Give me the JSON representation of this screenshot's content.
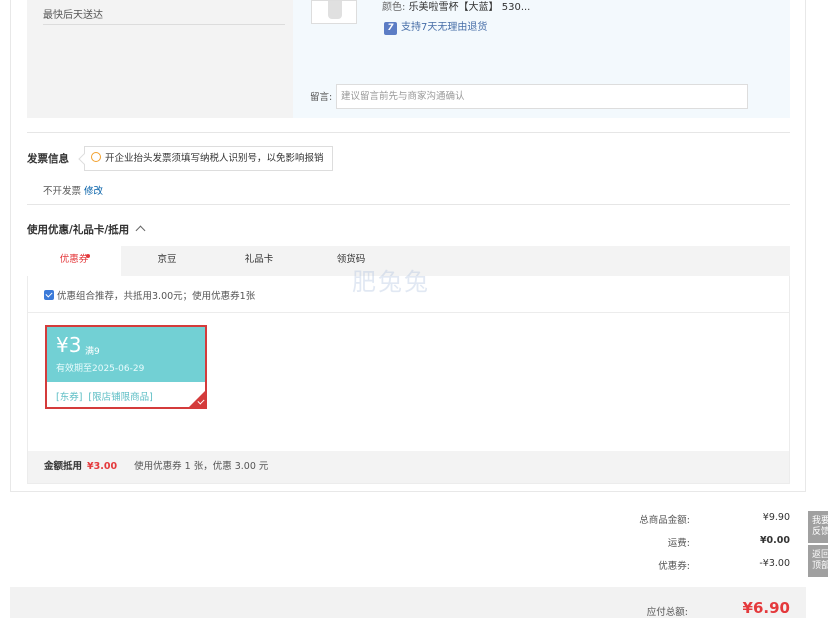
{
  "shipping": {
    "eta": "最快后天送达",
    "color_label": "颜色:",
    "color_value": "乐美啦雪杯【大蓝】 530...",
    "return_badge": "7",
    "return_text": "支持7天无理由退货",
    "message_label": "留言:",
    "message_placeholder": "建议留言前先与商家沟通确认"
  },
  "invoice": {
    "title": "发票信息",
    "tip": "开企业抬头发票须填写纳税人识别号，以免影响报销",
    "status": "不开发票",
    "edit_link": "修改"
  },
  "discount": {
    "title": "使用优惠/礼品卡/抵用",
    "tabs": [
      "优惠券",
      "京豆",
      "礼品卡",
      "领货码"
    ],
    "combo_text": "优惠组合推荐，共抵用3.00元；使用优惠券1张",
    "coupon": {
      "amount": "¥3",
      "condition": "满9",
      "expiry": "有效期至2025-06-29",
      "tag1": "[东券]",
      "tag2": "[限店铺限商品]"
    },
    "footer_label": "金额抵用",
    "footer_amount": "¥3.00",
    "footer_note": "使用优惠券 1 张，优惠 3.00 元"
  },
  "watermark": "肥兔兔",
  "totals": {
    "goods_label": "总商品金额:",
    "goods_value": "¥9.90",
    "shipping_label": "运费:",
    "shipping_value": "¥0.00",
    "coupon_label": "优惠券:",
    "coupon_value": "-¥3.00",
    "payable_label": "应付总额:",
    "payable_value": "¥6.90"
  },
  "side": {
    "feedback": "我要\n反馈",
    "top": "返回\n顶部"
  },
  "colors": {
    "accent_red": "#e4393c",
    "coupon_teal": "#72d0d4",
    "link_blue": "#005ea7"
  }
}
